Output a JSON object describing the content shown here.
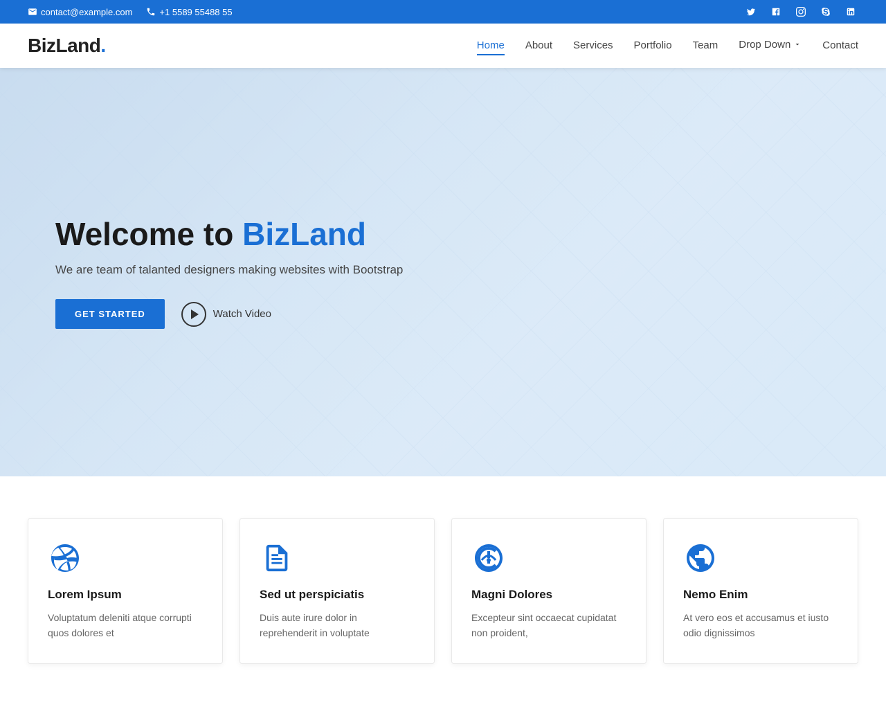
{
  "topbar": {
    "email_icon": "✉",
    "email": "contact@example.com",
    "phone_icon": "📞",
    "phone": "+1 5589 55488 55",
    "social_links": [
      {
        "name": "twitter",
        "label": "𝕏"
      },
      {
        "name": "facebook",
        "label": "f"
      },
      {
        "name": "instagram",
        "label": "◎"
      },
      {
        "name": "skype",
        "label": "S"
      },
      {
        "name": "linkedin",
        "label": "in"
      }
    ]
  },
  "navbar": {
    "logo_text": "BizLand",
    "logo_dot": ".",
    "nav_items": [
      {
        "label": "Home",
        "active": true
      },
      {
        "label": "About",
        "active": false
      },
      {
        "label": "Services",
        "active": false
      },
      {
        "label": "Portfolio",
        "active": false
      },
      {
        "label": "Team",
        "active": false
      },
      {
        "label": "Drop Down",
        "active": false,
        "has_dropdown": true
      },
      {
        "label": "Contact",
        "active": false
      }
    ]
  },
  "hero": {
    "title_prefix": "Welcome to ",
    "title_brand": "BizLand",
    "subtitle": "We are team of talanted designers making websites with Bootstrap",
    "cta_label": "GET STARTED",
    "watch_label": "Watch Video"
  },
  "features": [
    {
      "icon": "dribbble",
      "title": "Lorem Ipsum",
      "text": "Voluptatum deleniti atque corrupti quos dolores et"
    },
    {
      "icon": "document",
      "title": "Sed ut perspiciatis",
      "text": "Duis aute irure dolor in reprehenderit in voluptate"
    },
    {
      "icon": "speedometer",
      "title": "Magni Dolores",
      "text": "Excepteur sint occaecat cupidatat non proident,"
    },
    {
      "icon": "globe",
      "title": "Nemo Enim",
      "text": "At vero eos et accusamus et iusto odio dignissimos"
    }
  ]
}
